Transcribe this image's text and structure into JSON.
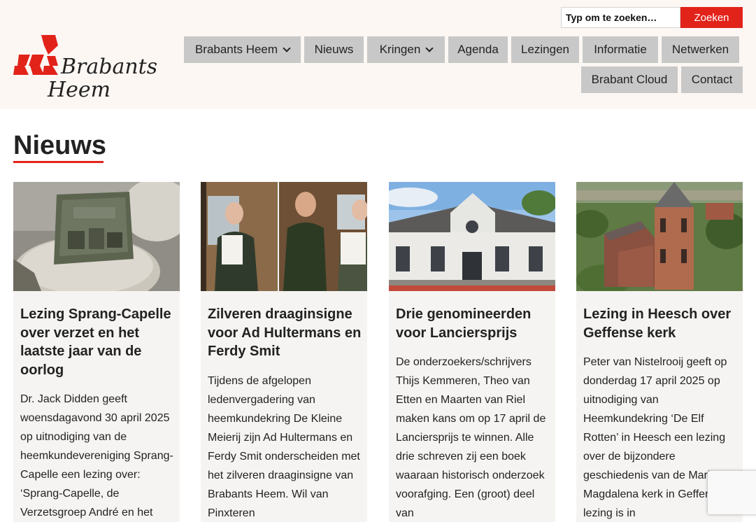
{
  "header": {
    "logo": {
      "line1": "Brabants",
      "line2": "Heem"
    },
    "search": {
      "placeholder": "Typ om te zoeken…",
      "value": "",
      "button_label": "Zoeken"
    },
    "nav": [
      {
        "label": "Brabants Heem",
        "has_dropdown": true
      },
      {
        "label": "Nieuws",
        "has_dropdown": false
      },
      {
        "label": "Kringen",
        "has_dropdown": true
      },
      {
        "label": "Agenda",
        "has_dropdown": false
      },
      {
        "label": "Lezingen",
        "has_dropdown": false
      },
      {
        "label": "Informatie",
        "has_dropdown": false
      },
      {
        "label": "Netwerken",
        "has_dropdown": false
      },
      {
        "label": "Brabant Cloud",
        "has_dropdown": false
      },
      {
        "label": "Contact",
        "has_dropdown": false
      }
    ]
  },
  "main": {
    "title": "Nieuws",
    "articles": [
      {
        "title": "Lezing Sprang-Capelle over verzet en het laatste jaar van de oorlog",
        "excerpt": "Dr. Jack Didden geeft woensdagavond 30 april  2025 op uitnodiging van de heemkundevereniging Sprang-Capelle een lezing over: ‘Sprang-Capelle, de Verzetsgroep André en het"
      },
      {
        "title": "Zilveren draaginsigne voor Ad Hultermans en Ferdy Smit",
        "excerpt": "Tijdens de afgelopen ledenvergadering van heemkundekring De Kleine Meierij zijn Ad Hultermans en Ferdy Smit onderscheiden met het zilveren draaginsigne van Brabants Heem. Wil van Pinxteren"
      },
      {
        "title": "Drie genomineerden voor Lanciersprijs",
        "excerpt": "De onderzoekers/schrijvers Thijs Kemmeren, Theo van Etten en Maarten van Riel maken kans om op 17 april de Lanciersprijs te winnen. Alle drie schreven zij een boek waaraan historisch onderzoek voorafging. Een (groot) deel van"
      },
      {
        "title": "Lezing in Heesch over Geffense kerk",
        "excerpt": "Peter van Nistelrooij geeft op donderdag 17 april 2025 op uitnodiging van Heemkundekring ‘De Elf Rotten’ in Heesch een lezing over de bijzondere geschiedenis van de Maria Magdalena kerk in Geffen. De lezing is in"
      }
    ]
  },
  "colors": {
    "accent": "#e2231a",
    "header_bg": "#fdf7f3",
    "nav_bg": "#c8c8c8",
    "card_bg": "#f5f4f2"
  }
}
